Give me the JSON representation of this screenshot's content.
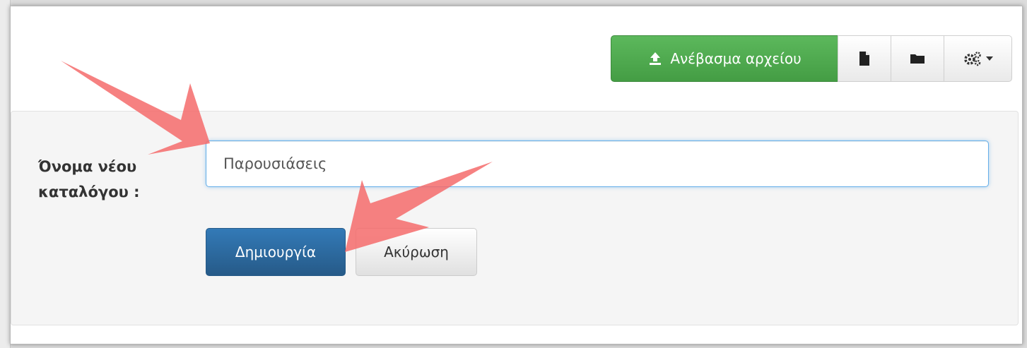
{
  "toolbar": {
    "upload_label": "Ανέβασμα αρχείου",
    "upload_icon": "upload-icon",
    "file_icon": "file-icon",
    "folder_icon": "folder-icon",
    "settings_icon": "gears-icon",
    "caret_icon": "caret-down-icon"
  },
  "form": {
    "label_line1": "Όνομα νέου",
    "label_line2": "καταλόγου :",
    "input_value": "Παρουσιάσεις",
    "create_label": "Δημιουργία",
    "cancel_label": "Ακύρωση"
  },
  "colors": {
    "upload_button": "#5cb85c",
    "create_button": "#337ab7",
    "annotation_arrow": "#f46b6b"
  }
}
